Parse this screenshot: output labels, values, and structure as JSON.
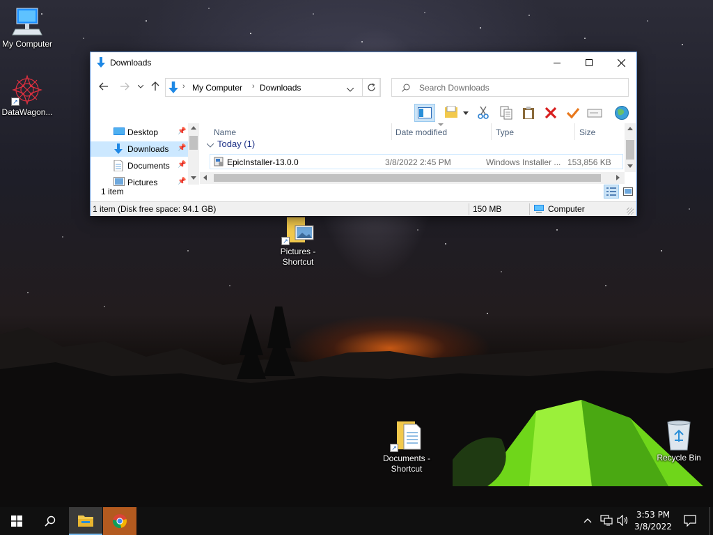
{
  "desktop": {
    "icons": [
      {
        "label": "My Computer"
      },
      {
        "label": "DataWagon..."
      },
      {
        "label": "Pictures - Shortcut"
      },
      {
        "label": "Documents - Shortcut"
      },
      {
        "label": "Recycle Bin"
      }
    ]
  },
  "window": {
    "title": "Downloads",
    "controls": {
      "minimize": "minimize-icon",
      "maximize": "maximize-icon",
      "close": "close-icon"
    },
    "address": {
      "segments": [
        "My Computer",
        "Downloads"
      ]
    },
    "search": {
      "placeholder": "Search Downloads"
    },
    "nav_pane": {
      "items": [
        {
          "label": "Desktop",
          "selected": false
        },
        {
          "label": "Downloads",
          "selected": true
        },
        {
          "label": "Documents",
          "selected": false
        },
        {
          "label": "Pictures",
          "selected": false
        }
      ]
    },
    "item_count": "1 item",
    "columns": [
      "Name",
      "Date modified",
      "Type",
      "Size"
    ],
    "group": "Today (1)",
    "files": [
      {
        "name": "EpicInstaller-13.0.0",
        "date": "3/8/2022 2:45 PM",
        "type": "Windows Installer ...",
        "size": "153,856 KB"
      }
    ],
    "status": {
      "summary": "1 item (Disk free space: 94.1 GB)",
      "size": "150 MB",
      "location": "Computer"
    }
  },
  "taskbar": {
    "time": "3:53 PM",
    "date": "3/8/2022"
  },
  "colors": {
    "accent": "#0078d7",
    "selection": "#cce8ff",
    "taskbar": "#101010",
    "window_border": "#5b8ccf"
  }
}
